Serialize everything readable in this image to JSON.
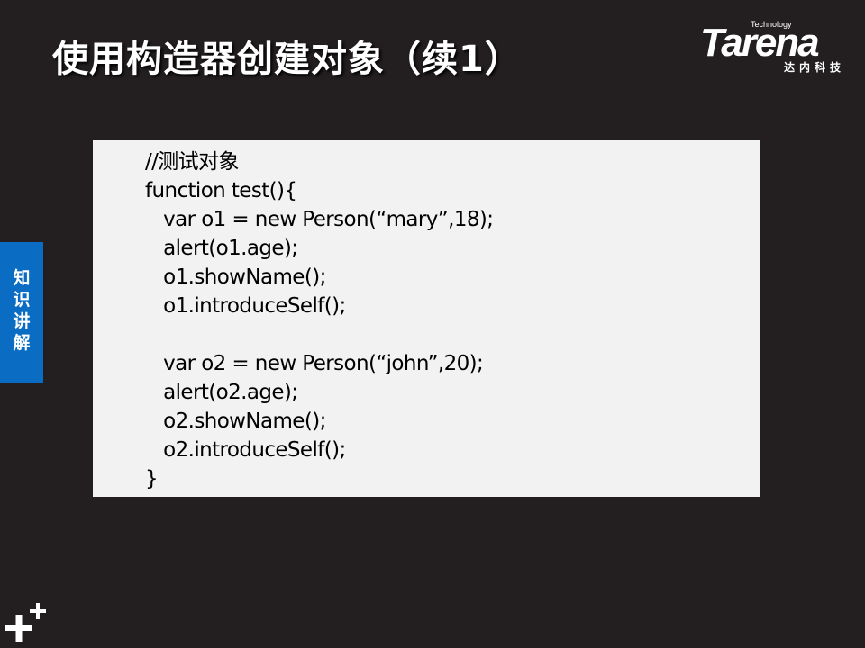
{
  "slide": {
    "title": "使用构造器创建对象（续1）",
    "background_color": "#231f20"
  },
  "logo": {
    "technology": "Technology",
    "wordmark": "Tarena",
    "chinese": "达内科技"
  },
  "side_tab": {
    "label": "知识讲解",
    "color": "#0a6cc2"
  },
  "code_panel": {
    "lines": [
      "//测试对象",
      "function test(){",
      "   var o1 = new Person(“mary”,18);",
      "   alert(o1.age);",
      "   o1.showName();",
      "   o1.introduceSelf();",
      "",
      "   var o2 = new Person(“john”,20);",
      "   alert(o2.age);",
      "   o2.showName();",
      "   o2.introduceSelf();",
      "}"
    ]
  },
  "corner_mark": {
    "icon": "plus-plus-icon"
  }
}
